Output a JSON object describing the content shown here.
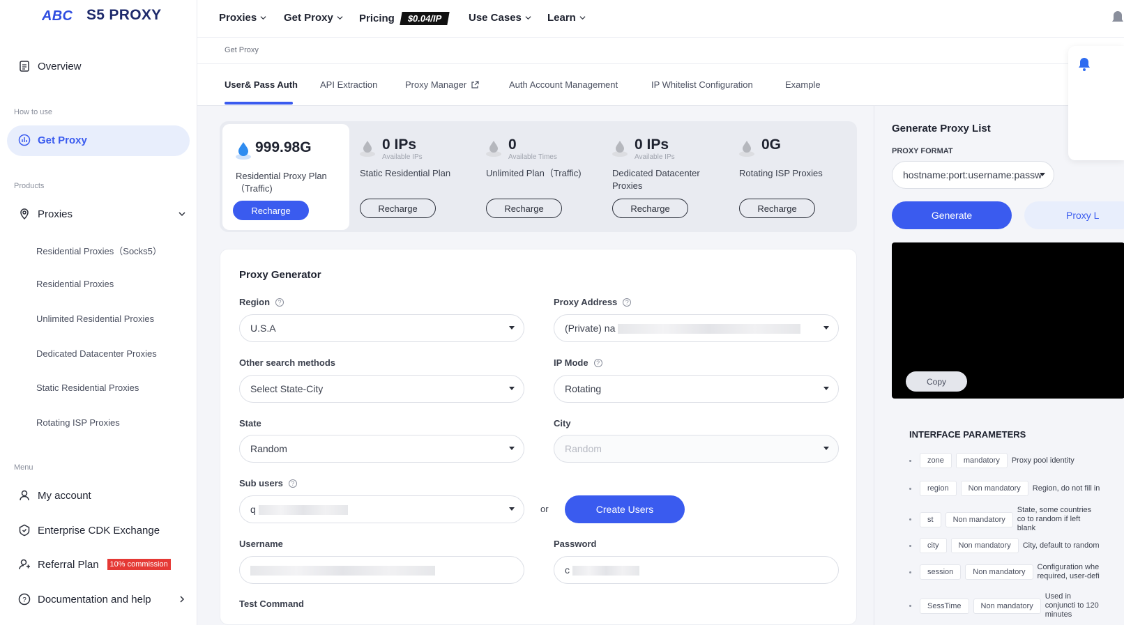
{
  "brand": {
    "name": "S5 PROXY",
    "accent": "#3a5bef"
  },
  "sidebar": {
    "overview": "Overview",
    "how_to_use_label": "How to use",
    "get_proxy": "Get Proxy",
    "products_label": "Products",
    "proxies": "Proxies",
    "sub_items": [
      "Residential Proxies（Socks5）",
      "Residential Proxies",
      "Unlimited Residential Proxies",
      "Dedicated Datacenter Proxies",
      "Static Residential Proxies",
      "Rotating ISP Proxies"
    ],
    "menu_label": "Menu",
    "my_account": "My account",
    "enterprise": "Enterprise CDK Exchange",
    "referral": "Referral Plan",
    "referral_badge": "10% commission",
    "docs": "Documentation and help"
  },
  "topnav": {
    "proxies": "Proxies",
    "get_proxy": "Get Proxy",
    "pricing": "Pricing",
    "price_tag": "$0.04/IP",
    "use_cases": "Use Cases",
    "learn": "Learn"
  },
  "breadcrumb": "Get Proxy",
  "tabs": [
    "User& Pass Auth",
    "API Extraction",
    "Proxy Manager",
    "Auth Account Management",
    "IP Whitelist Configuration",
    "Example"
  ],
  "plans": [
    {
      "value": "999.98G",
      "unit": "",
      "name": "Residential Proxy Plan（Traffic)",
      "button": "Recharge"
    },
    {
      "value": "0 IPs",
      "unit": "Available IPs",
      "name": "Static Residential Plan",
      "button": "Recharge"
    },
    {
      "value": "0",
      "unit": "Available Times",
      "name": "Unlimited Plan（Traffic)",
      "button": "Recharge"
    },
    {
      "value": "0 IPs",
      "unit": "Available IPs",
      "name": "Dedicated Datacenter Proxies",
      "button": "Recharge"
    },
    {
      "value": "0G",
      "unit": "",
      "name": "Rotating ISP Proxies",
      "button": "Recharge"
    }
  ],
  "generator": {
    "title": "Proxy Generator",
    "region_label": "Region",
    "region_value": "U.S.A",
    "address_label": "Proxy Address",
    "address_value": "(Private) na",
    "other_label": "Other search methods",
    "other_value": "Select State-City",
    "ipmode_label": "IP Mode",
    "ipmode_value": "Rotating",
    "state_label": "State",
    "state_value": "Random",
    "city_label": "City",
    "city_value": "Random",
    "subusers_label": "Sub users",
    "subusers_value": "q",
    "or": "or",
    "create_users": "Create Users",
    "username_label": "Username",
    "password_label": "Password",
    "password_value": "c",
    "test_label": "Test Command"
  },
  "right": {
    "title": "Generate Proxy List",
    "format_label": "PROXY FORMAT",
    "format_value": "hostname:port:username:passw",
    "generate": "Generate",
    "proxy_list": "Proxy L",
    "copy": "Copy",
    "params_title": "INTERFACE PARAMETERS",
    "params": [
      {
        "key": "zone",
        "req": "mandatory",
        "desc": "Proxy pool identity"
      },
      {
        "key": "region",
        "req": "Non mandatory",
        "desc": "Region, do not fill in"
      },
      {
        "key": "st",
        "req": "Non mandatory",
        "desc": "State, some countries co to random if left blank"
      },
      {
        "key": "city",
        "req": "Non mandatory",
        "desc": "City, default to random"
      },
      {
        "key": "session",
        "req": "Non mandatory",
        "desc": "Configuration whe required, user-defi"
      },
      {
        "key": "SessTime",
        "req": "Non mandatory",
        "desc": "Used in conjuncti to 120 minutes"
      }
    ]
  }
}
